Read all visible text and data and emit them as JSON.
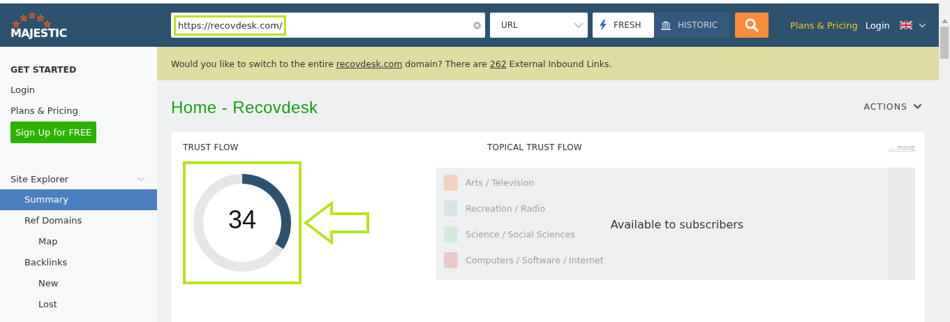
{
  "header": {
    "logo": "MAJESTIC",
    "search": {
      "value": "https://recovdesk.com/"
    },
    "mode_select": "URL",
    "index_toggle": [
      {
        "label": "FRESH",
        "selected": true
      },
      {
        "label": "HISTORIC",
        "selected": false
      }
    ],
    "links": [
      "Plans & Pricing",
      "Login"
    ]
  },
  "banner": {
    "before": "Would you like to switch to the entire ",
    "domain": "recovdesk.com",
    "middle": " domain? There are ",
    "count": "262",
    "after": " External Inbound Links."
  },
  "sidebar": {
    "heading": "GET STARTED",
    "links": [
      "Login",
      "Plans & Pricing"
    ],
    "signup": "Sign Up for FREE",
    "nav": [
      {
        "label": "Site Explorer",
        "expanded": true,
        "selected": false,
        "children": [
          {
            "label": "Summary",
            "selected": true
          },
          {
            "label": "Ref Domains",
            "selected": false,
            "children": [
              {
                "label": "Map",
                "selected": false
              }
            ]
          },
          {
            "label": "Backlinks",
            "selected": false,
            "children": [
              {
                "label": "New",
                "selected": false
              },
              {
                "label": "Lost",
                "selected": false
              }
            ]
          }
        ]
      }
    ]
  },
  "page": {
    "title": "Home - Recovdesk",
    "actions": "ACTIONS"
  },
  "trust_flow": {
    "title": "TRUST FLOW",
    "value": "34"
  },
  "topical": {
    "title": "TOPICAL TRUST FLOW",
    "more": "... more",
    "overlay": "Available to subscribers",
    "items": [
      {
        "label": "Arts / Television",
        "color": "#f2d3bf"
      },
      {
        "label": "Recreation / Radio",
        "color": "#d8e5e7"
      },
      {
        "label": "Science / Social Sciences",
        "color": "#d3eadd"
      },
      {
        "label": "Computers / Software / Internet",
        "color": "#eac9cc"
      }
    ]
  }
}
